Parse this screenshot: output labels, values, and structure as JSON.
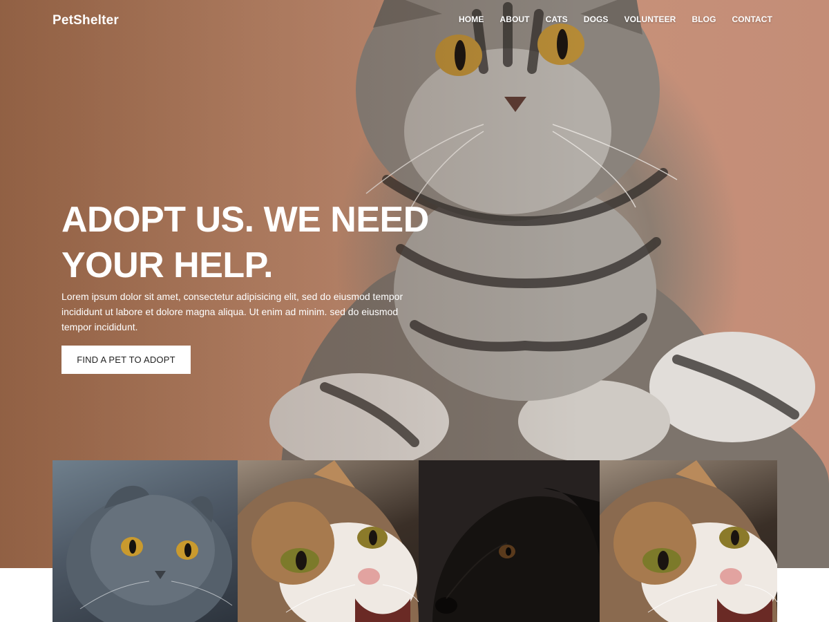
{
  "brand": {
    "name": "PetShelter"
  },
  "nav": {
    "items": [
      "HOME",
      "ABOUT",
      "CATS",
      "DOGS",
      "VOLUNTEER",
      "BLOG",
      "CONTACT"
    ]
  },
  "hero": {
    "title_line1": "ADOPT US. WE NEED",
    "title_line2": "YOUR HELP.",
    "text": "Lorem ipsum dolor sit amet, consectetur adipisicing elit, sed do eiusmod tempor incididunt ut labore et dolore magna aliqua. Ut enim ad minim. sed do eiusmod tempor incididunt.",
    "cta_label": "FIND A PET TO ADOPT",
    "image": "tabby-cat-photo"
  },
  "gallery": {
    "tiles": [
      {
        "image": "grey-fold-cat-photo"
      },
      {
        "image": "calico-cat-photo"
      },
      {
        "image": "black-dog-photo"
      },
      {
        "image": "calico-cat-photo"
      }
    ]
  },
  "colors": {
    "hero_background": "#c08a6c",
    "cta_background": "#ffffff",
    "text_light": "#ffffff"
  }
}
